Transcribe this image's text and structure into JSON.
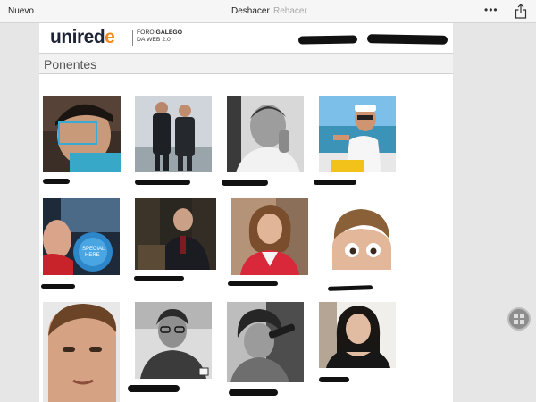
{
  "toolbar": {
    "new_label": "Nuevo",
    "undo_label": "Deshacer",
    "redo_label": "Rehacer",
    "more_label": "•••"
  },
  "header": {
    "logo_text_a": "unired",
    "logo_text_b": "e",
    "logo_line1_a": "FORO ",
    "logo_line1_b": "GALEGO",
    "logo_line2": "DA WEB 2.0"
  },
  "section": {
    "title": "Ponentes"
  },
  "speakers": [
    {
      "photo": "man-with-face-detection-box"
    },
    {
      "photo": "two-men-in-suits"
    },
    {
      "photo": "man-bw-hand-on-chin"
    },
    {
      "photo": "man-on-boat-cap-sunglasses"
    },
    {
      "photo": "bald-man-with-badge"
    },
    {
      "photo": "man-in-suit-office"
    },
    {
      "photo": "woman-red-jacket"
    },
    {
      "photo": "man-peeking-surprised"
    },
    {
      "photo": "man-closeup-face"
    },
    {
      "photo": "man-bw-glasses"
    },
    {
      "photo": "man-bw-microphone"
    },
    {
      "photo": "young-woman-dark-hair"
    }
  ],
  "colors": {
    "accent_orange": "#f28a1c",
    "logo_navy": "#1c2436",
    "redaction": "#111111"
  }
}
